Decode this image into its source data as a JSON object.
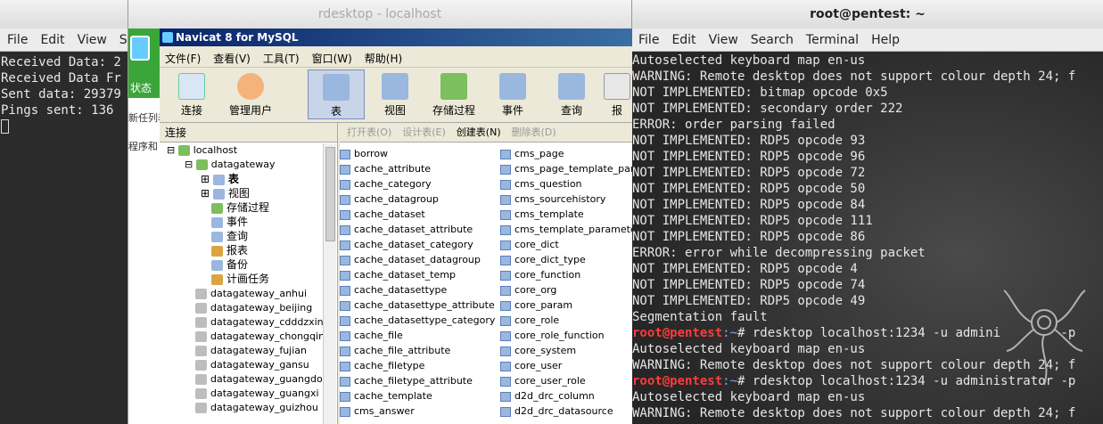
{
  "left_terminal": {
    "menu": [
      "File",
      "Edit",
      "View",
      "S"
    ],
    "lines": [
      "Received Data: 2",
      "Received Data Fr",
      "Sent data: 29379",
      "Pings sent: 136"
    ]
  },
  "rdesktop": {
    "title": "rdesktop - localhost",
    "behind": {
      "status": "状态",
      "text1": "新任列表",
      "text2": "程序和"
    },
    "navicat": {
      "title": "Navicat 8 for MySQL",
      "menu": [
        "文件(F)",
        "查看(V)",
        "工具(T)",
        "窗口(W)",
        "帮助(H)"
      ],
      "tools": [
        "连接",
        "管理用户",
        "表",
        "视图",
        "存储过程",
        "事件",
        "查询",
        "报"
      ],
      "conn_header": "连接",
      "tree": {
        "root": "localhost",
        "db": "datagateway",
        "sub": [
          "表",
          "视图",
          "存储过程",
          "事件",
          "查询",
          "报表",
          "备份",
          "计画任务"
        ],
        "others": [
          "datagateway_anhui",
          "datagateway_beijing",
          "datagateway_cdddzxin",
          "datagateway_chongqing",
          "datagateway_fujian",
          "datagateway_gansu",
          "datagateway_guangdon",
          "datagateway_guangxi",
          "datagateway_guizhou"
        ]
      },
      "tbl_bar": [
        "打开表(O)",
        "设计表(E)",
        "创建表(N)",
        "删除表(D)"
      ],
      "tables_col1": [
        "borrow",
        "cache_attribute",
        "cache_category",
        "cache_datagroup",
        "cache_dataset",
        "cache_dataset_attribute",
        "cache_dataset_category",
        "cache_dataset_datagroup",
        "cache_dataset_temp",
        "cache_datasettype",
        "cache_datasettype_attribute",
        "cache_datasettype_category",
        "cache_file",
        "cache_file_attribute",
        "cache_filetype",
        "cache_filetype_attribute",
        "cache_template",
        "cms_answer"
      ],
      "tables_col2": [
        "cms_page",
        "cms_page_template_para",
        "cms_question",
        "cms_sourcehistory",
        "cms_template",
        "cms_template_parameter",
        "core_dict",
        "core_dict_type",
        "core_function",
        "core_org",
        "core_param",
        "core_role",
        "core_role_function",
        "core_system",
        "core_user",
        "core_user_role",
        "d2d_drc_column",
        "d2d_drc_datasource"
      ]
    }
  },
  "right_terminal": {
    "title": "root@pentest: ~",
    "menu": [
      "File",
      "Edit",
      "View",
      "Search",
      "Terminal",
      "Help"
    ],
    "lines": [
      "Autoselected keyboard map en-us",
      "WARNING: Remote desktop does not support colour depth 24; f",
      "NOT IMPLEMENTED: bitmap opcode 0x5",
      "NOT IMPLEMENTED: secondary order 222",
      "ERROR: order parsing failed",
      "NOT IMPLEMENTED: RDP5 opcode 93",
      "NOT IMPLEMENTED: RDP5 opcode 96",
      "NOT IMPLEMENTED: RDP5 opcode 72",
      "NOT IMPLEMENTED: RDP5 opcode 50",
      "NOT IMPLEMENTED: RDP5 opcode 84",
      "NOT IMPLEMENTED: RDP5 opcode 111",
      "NOT IMPLEMENTED: RDP5 opcode 86",
      "ERROR: error while decompressing packet",
      "NOT IMPLEMENTED: RDP5 opcode 4",
      "NOT IMPLEMENTED: RDP5 opcode 74",
      "NOT IMPLEMENTED: RDP5 opcode 49",
      "Segmentation fault"
    ],
    "prompt_user": "root@pentest",
    "prompt_path": ":~",
    "cmd1": "# rdesktop localhost:1234 -u admini        -p",
    "lines2": [
      "Autoselected keyboard map en-us",
      "WARNING: Remote desktop does not support colour depth 24; f"
    ],
    "cmd2": "# rdesktop localhost:1234 -u administrator -p",
    "lines3": [
      "Autoselected keyboard map en-us",
      "WARNING: Remote desktop does not support colour depth 24; f"
    ]
  }
}
